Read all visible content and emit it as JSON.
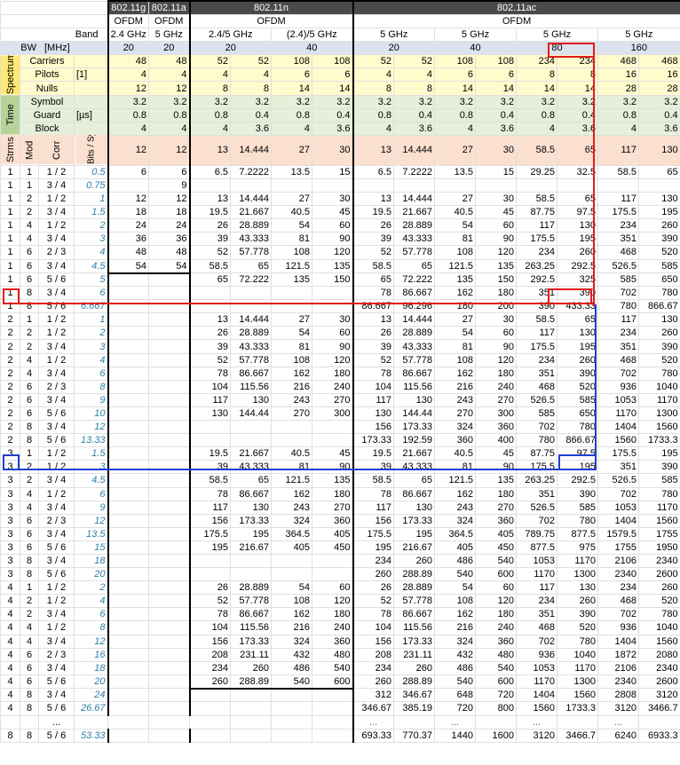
{
  "title_row": [
    "802.11g",
    "802.11a",
    "802.11n",
    "802.11ac"
  ],
  "modulation_row": [
    "OFDM",
    "OFDM",
    "OFDM",
    "OFDM"
  ],
  "band_label": "Band",
  "bands": [
    "2.4 GHz",
    "5 GHz",
    "2.4/5 GHz",
    "(2.4)/5 GHz",
    "5 GHz",
    "5 GHz",
    "5 GHz",
    "5 GHz"
  ],
  "bw_label": "BW",
  "bw_unit": "[MHz]",
  "bw_values": [
    "20",
    "20",
    "20",
    "40",
    "20",
    "40",
    "80",
    "160"
  ],
  "spectrum_label": "Spectrum",
  "time_label": "Time",
  "params": [
    {
      "label": "Carriers",
      "unit": "",
      "values": [
        "48",
        "48",
        "52",
        "52",
        "108",
        "108",
        "52",
        "52",
        "108",
        "108",
        "234",
        "234",
        "468",
        "468"
      ]
    },
    {
      "label": "Pilots",
      "unit": "[1]",
      "values": [
        "4",
        "4",
        "4",
        "4",
        "6",
        "6",
        "4",
        "4",
        "6",
        "6",
        "8",
        "8",
        "16",
        "16"
      ]
    },
    {
      "label": "Nulls",
      "unit": "",
      "values": [
        "12",
        "12",
        "8",
        "8",
        "14",
        "14",
        "8",
        "8",
        "14",
        "14",
        "14",
        "14",
        "28",
        "28"
      ]
    },
    {
      "label": "Symbol",
      "unit": "",
      "values": [
        "3.2",
        "3.2",
        "3.2",
        "3.2",
        "3.2",
        "3.2",
        "3.2",
        "3.2",
        "3.2",
        "3.2",
        "3.2",
        "3.2",
        "3.2",
        "3.2"
      ]
    },
    {
      "label": "Guard",
      "unit": "[µs]",
      "values": [
        "0.8",
        "0.8",
        "0.8",
        "0.4",
        "0.8",
        "0.4",
        "0.8",
        "0.4",
        "0.8",
        "0.4",
        "0.8",
        "0.4",
        "0.8",
        "0.4"
      ]
    },
    {
      "label": "Block",
      "unit": "",
      "values": [
        "4",
        "4",
        "4",
        "3.6",
        "4",
        "3.6",
        "4",
        "3.6",
        "4",
        "3.6",
        "4",
        "3.6",
        "4",
        "3.6"
      ]
    }
  ],
  "col_headers": {
    "strms": "Strms",
    "mod": "Mod",
    "corr": "Corr",
    "bits": "Bits / Symb"
  },
  "bits_row": [
    "12",
    "12",
    "13",
    "14.444",
    "27",
    "30",
    "13",
    "14.444",
    "27",
    "30",
    "58.5",
    "65",
    "117",
    "130"
  ],
  "rows": [
    {
      "s": "1",
      "m": "1",
      "c": "1 / 2",
      "b": "0.5",
      "v": [
        "6",
        "6",
        "6.5",
        "7.2222",
        "13.5",
        "15",
        "6.5",
        "7.2222",
        "13.5",
        "15",
        "29.25",
        "32.5",
        "58.5",
        "65"
      ]
    },
    {
      "s": "1",
      "m": "1",
      "c": "3 / 4",
      "b": "0.75",
      "v": [
        "",
        "9",
        "",
        "",
        "",
        "",
        "",
        "",
        "",
        "",
        "",
        "",
        "",
        ""
      ]
    },
    {
      "s": "1",
      "m": "2",
      "c": "1 / 2",
      "b": "1",
      "v": [
        "12",
        "12",
        "13",
        "14.444",
        "27",
        "30",
        "13",
        "14.444",
        "27",
        "30",
        "58.5",
        "65",
        "117",
        "130"
      ]
    },
    {
      "s": "1",
      "m": "2",
      "c": "3 / 4",
      "b": "1.5",
      "v": [
        "18",
        "18",
        "19.5",
        "21.667",
        "40.5",
        "45",
        "19.5",
        "21.667",
        "40.5",
        "45",
        "87.75",
        "97.5",
        "175.5",
        "195"
      ]
    },
    {
      "s": "1",
      "m": "4",
      "c": "1 / 2",
      "b": "2",
      "v": [
        "24",
        "24",
        "26",
        "28.889",
        "54",
        "60",
        "26",
        "28.889",
        "54",
        "60",
        "117",
        "130",
        "234",
        "260"
      ]
    },
    {
      "s": "1",
      "m": "4",
      "c": "3 / 4",
      "b": "3",
      "v": [
        "36",
        "36",
        "39",
        "43.333",
        "81",
        "90",
        "39",
        "43.333",
        "81",
        "90",
        "175.5",
        "195",
        "351",
        "390"
      ]
    },
    {
      "s": "1",
      "m": "6",
      "c": "2 / 3",
      "b": "4",
      "v": [
        "48",
        "48",
        "52",
        "57.778",
        "108",
        "120",
        "52",
        "57.778",
        "108",
        "120",
        "234",
        "260",
        "468",
        "520"
      ]
    },
    {
      "s": "1",
      "m": "6",
      "c": "3 / 4",
      "b": "4.5",
      "v": [
        "54",
        "54",
        "58.5",
        "65",
        "121.5",
        "135",
        "58.5",
        "65",
        "121.5",
        "135",
        "263.25",
        "292.5",
        "526.5",
        "585"
      ]
    },
    {
      "s": "1",
      "m": "6",
      "c": "5 / 6",
      "b": "5",
      "v": [
        "",
        "",
        "65",
        "72.222",
        "135",
        "150",
        "65",
        "72.222",
        "135",
        "150",
        "292.5",
        "325",
        "585",
        "650"
      ]
    },
    {
      "s": "1",
      "m": "8",
      "c": "3 / 4",
      "b": "6",
      "v": [
        "",
        "",
        "",
        "",
        "",
        "",
        "78",
        "86.667",
        "162",
        "180",
        "351",
        "390",
        "702",
        "780"
      ]
    },
    {
      "s": "1",
      "m": "8",
      "c": "5 / 6",
      "b": "6.667",
      "v": [
        "",
        "",
        "",
        "",
        "",
        "",
        "86.667",
        "96.296",
        "180",
        "200",
        "390",
        "433.33",
        "780",
        "866.67"
      ]
    },
    {
      "s": "2",
      "m": "1",
      "c": "1 / 2",
      "b": "1",
      "v": [
        "",
        "",
        "13",
        "14.444",
        "27",
        "30",
        "13",
        "14.444",
        "27",
        "30",
        "58.5",
        "65",
        "117",
        "130"
      ]
    },
    {
      "s": "2",
      "m": "2",
      "c": "1 / 2",
      "b": "2",
      "v": [
        "",
        "",
        "26",
        "28.889",
        "54",
        "60",
        "26",
        "28.889",
        "54",
        "60",
        "117",
        "130",
        "234",
        "260"
      ]
    },
    {
      "s": "2",
      "m": "2",
      "c": "3 / 4",
      "b": "3",
      "v": [
        "",
        "",
        "39",
        "43.333",
        "81",
        "90",
        "39",
        "43.333",
        "81",
        "90",
        "175.5",
        "195",
        "351",
        "390"
      ]
    },
    {
      "s": "2",
      "m": "4",
      "c": "1 / 2",
      "b": "4",
      "v": [
        "",
        "",
        "52",
        "57.778",
        "108",
        "120",
        "52",
        "57.778",
        "108",
        "120",
        "234",
        "260",
        "468",
        "520"
      ]
    },
    {
      "s": "2",
      "m": "4",
      "c": "3 / 4",
      "b": "6",
      "v": [
        "",
        "",
        "78",
        "86.667",
        "162",
        "180",
        "78",
        "86.667",
        "162",
        "180",
        "351",
        "390",
        "702",
        "780"
      ]
    },
    {
      "s": "2",
      "m": "6",
      "c": "2 / 3",
      "b": "8",
      "v": [
        "",
        "",
        "104",
        "115.56",
        "216",
        "240",
        "104",
        "115.56",
        "216",
        "240",
        "468",
        "520",
        "936",
        "1040"
      ]
    },
    {
      "s": "2",
      "m": "6",
      "c": "3 / 4",
      "b": "9",
      "v": [
        "",
        "",
        "117",
        "130",
        "243",
        "270",
        "117",
        "130",
        "243",
        "270",
        "526.5",
        "585",
        "1053",
        "1170"
      ]
    },
    {
      "s": "2",
      "m": "6",
      "c": "5 / 6",
      "b": "10",
      "v": [
        "",
        "",
        "130",
        "144.44",
        "270",
        "300",
        "130",
        "144.44",
        "270",
        "300",
        "585",
        "650",
        "1170",
        "1300"
      ]
    },
    {
      "s": "2",
      "m": "8",
      "c": "3 / 4",
      "b": "12",
      "v": [
        "",
        "",
        "",
        "",
        "",
        "",
        "156",
        "173.33",
        "324",
        "360",
        "702",
        "780",
        "1404",
        "1560"
      ]
    },
    {
      "s": "2",
      "m": "8",
      "c": "5 / 6",
      "b": "13.33",
      "v": [
        "",
        "",
        "",
        "",
        "",
        "",
        "173.33",
        "192.59",
        "360",
        "400",
        "780",
        "866.67",
        "1560",
        "1733.3"
      ]
    },
    {
      "s": "3",
      "m": "1",
      "c": "1 / 2",
      "b": "1.5",
      "v": [
        "",
        "",
        "19.5",
        "21.667",
        "40.5",
        "45",
        "19.5",
        "21.667",
        "40.5",
        "45",
        "87.75",
        "97.5",
        "175.5",
        "195"
      ]
    },
    {
      "s": "3",
      "m": "2",
      "c": "1 / 2",
      "b": "3",
      "v": [
        "",
        "",
        "39",
        "43.333",
        "81",
        "90",
        "39",
        "43.333",
        "81",
        "90",
        "175.5",
        "195",
        "351",
        "390"
      ]
    },
    {
      "s": "3",
      "m": "2",
      "c": "3 / 4",
      "b": "4.5",
      "v": [
        "",
        "",
        "58.5",
        "65",
        "121.5",
        "135",
        "58.5",
        "65",
        "121.5",
        "135",
        "263.25",
        "292.5",
        "526.5",
        "585"
      ]
    },
    {
      "s": "3",
      "m": "4",
      "c": "1 / 2",
      "b": "6",
      "v": [
        "",
        "",
        "78",
        "86.667",
        "162",
        "180",
        "78",
        "86.667",
        "162",
        "180",
        "351",
        "390",
        "702",
        "780"
      ]
    },
    {
      "s": "3",
      "m": "4",
      "c": "3 / 4",
      "b": "9",
      "v": [
        "",
        "",
        "117",
        "130",
        "243",
        "270",
        "117",
        "130",
        "243",
        "270",
        "526.5",
        "585",
        "1053",
        "1170"
      ]
    },
    {
      "s": "3",
      "m": "6",
      "c": "2 / 3",
      "b": "12",
      "v": [
        "",
        "",
        "156",
        "173.33",
        "324",
        "360",
        "156",
        "173.33",
        "324",
        "360",
        "702",
        "780",
        "1404",
        "1560"
      ]
    },
    {
      "s": "3",
      "m": "6",
      "c": "3 / 4",
      "b": "13.5",
      "v": [
        "",
        "",
        "175.5",
        "195",
        "364.5",
        "405",
        "175.5",
        "195",
        "364.5",
        "405",
        "789.75",
        "877.5",
        "1579.5",
        "1755"
      ]
    },
    {
      "s": "3",
      "m": "6",
      "c": "5 / 6",
      "b": "15",
      "v": [
        "",
        "",
        "195",
        "216.67",
        "405",
        "450",
        "195",
        "216.67",
        "405",
        "450",
        "877.5",
        "975",
        "1755",
        "1950"
      ]
    },
    {
      "s": "3",
      "m": "8",
      "c": "3 / 4",
      "b": "18",
      "v": [
        "",
        "",
        "",
        "",
        "",
        "",
        "234",
        "260",
        "486",
        "540",
        "1053",
        "1170",
        "2106",
        "2340"
      ]
    },
    {
      "s": "3",
      "m": "8",
      "c": "5 / 6",
      "b": "20",
      "v": [
        "",
        "",
        "",
        "",
        "",
        "",
        "260",
        "288.89",
        "540",
        "600",
        "1170",
        "1300",
        "2340",
        "2600"
      ]
    },
    {
      "s": "4",
      "m": "1",
      "c": "1 / 2",
      "b": "2",
      "v": [
        "",
        "",
        "26",
        "28.889",
        "54",
        "60",
        "26",
        "28.889",
        "54",
        "60",
        "117",
        "130",
        "234",
        "260"
      ]
    },
    {
      "s": "4",
      "m": "2",
      "c": "1 / 2",
      "b": "4",
      "v": [
        "",
        "",
        "52",
        "57.778",
        "108",
        "120",
        "52",
        "57.778",
        "108",
        "120",
        "234",
        "260",
        "468",
        "520"
      ]
    },
    {
      "s": "4",
      "m": "2",
      "c": "3 / 4",
      "b": "6",
      "v": [
        "",
        "",
        "78",
        "86.667",
        "162",
        "180",
        "78",
        "86.667",
        "162",
        "180",
        "351",
        "390",
        "702",
        "780"
      ]
    },
    {
      "s": "4",
      "m": "4",
      "c": "1 / 2",
      "b": "8",
      "v": [
        "",
        "",
        "104",
        "115.56",
        "216",
        "240",
        "104",
        "115.56",
        "216",
        "240",
        "468",
        "520",
        "936",
        "1040"
      ]
    },
    {
      "s": "4",
      "m": "4",
      "c": "3 / 4",
      "b": "12",
      "v": [
        "",
        "",
        "156",
        "173.33",
        "324",
        "360",
        "156",
        "173.33",
        "324",
        "360",
        "702",
        "780",
        "1404",
        "1560"
      ]
    },
    {
      "s": "4",
      "m": "6",
      "c": "2 / 3",
      "b": "16",
      "v": [
        "",
        "",
        "208",
        "231.11",
        "432",
        "480",
        "208",
        "231.11",
        "432",
        "480",
        "936",
        "1040",
        "1872",
        "2080"
      ]
    },
    {
      "s": "4",
      "m": "6",
      "c": "3 / 4",
      "b": "18",
      "v": [
        "",
        "",
        "234",
        "260",
        "486",
        "540",
        "234",
        "260",
        "486",
        "540",
        "1053",
        "1170",
        "2106",
        "2340"
      ]
    },
    {
      "s": "4",
      "m": "6",
      "c": "5 / 6",
      "b": "20",
      "v": [
        "",
        "",
        "260",
        "288.89",
        "540",
        "600",
        "260",
        "288.89",
        "540",
        "600",
        "1170",
        "1300",
        "2340",
        "2600"
      ]
    },
    {
      "s": "4",
      "m": "8",
      "c": "3 / 4",
      "b": "24",
      "v": [
        "",
        "",
        "",
        "",
        "",
        "",
        "312",
        "346.67",
        "648",
        "720",
        "1404",
        "1560",
        "2808",
        "3120"
      ]
    },
    {
      "s": "4",
      "m": "8",
      "c": "5 / 6",
      "b": "26.67",
      "v": [
        "",
        "",
        "",
        "",
        "",
        "",
        "346.67",
        "385.19",
        "720",
        "800",
        "1560",
        "1733.3",
        "3120",
        "3466.7"
      ]
    }
  ],
  "ellipsis": "...",
  "last_row": {
    "s": "8",
    "m": "8",
    "c": "5 / 6",
    "b": "53.33",
    "v": [
      "",
      "",
      "",
      "",
      "",
      "",
      "693.33",
      "770.37",
      "1440",
      "1600",
      "3120",
      "3466.7",
      "6240",
      "6933.3"
    ]
  },
  "highlight_colors": {
    "red": "#e31b1b",
    "blue": "#1f3fd0"
  }
}
